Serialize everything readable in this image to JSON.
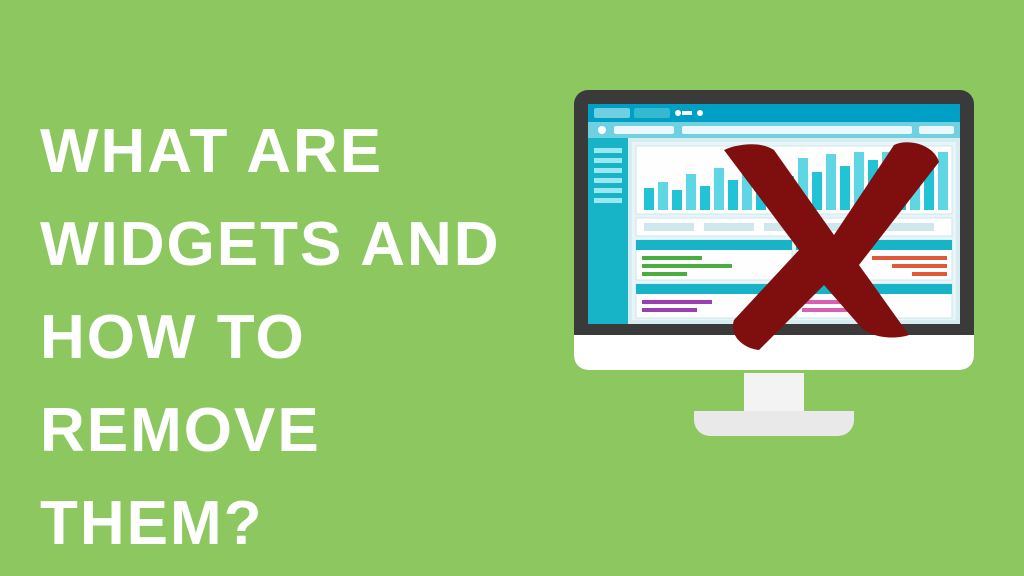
{
  "headline": "What are widgets and how to remove them?",
  "colors": {
    "background": "#8dc760",
    "text": "#ffffff",
    "bezel": "#3a3a3a",
    "chin": "#ffffff",
    "x_mark": "#7f0f0f",
    "dashboard": {
      "header": "#009fc5",
      "bg": "#d7ecf1",
      "sidebar": "#17b3c7",
      "charts": [
        "#22c3d6",
        "#5ed6e3"
      ],
      "lines_purple": "#9a3fb1",
      "lines_pink": "#d85fb2",
      "lines_green": "#4aad3f",
      "lines_red": "#e05a3a"
    }
  }
}
